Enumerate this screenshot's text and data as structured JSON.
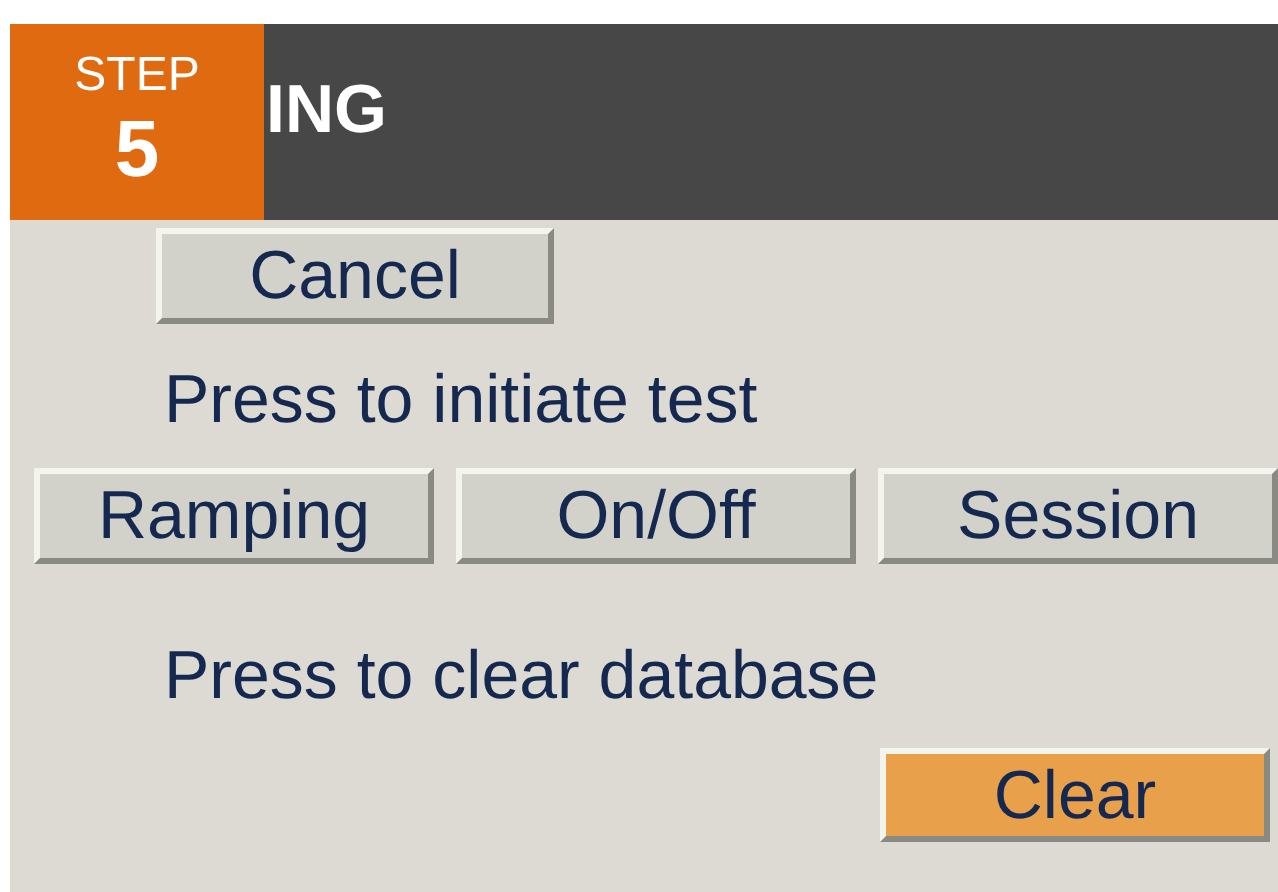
{
  "step_badge": {
    "label": "STEP",
    "number": "5"
  },
  "window": {
    "title": "ING"
  },
  "cancel_button": "Cancel",
  "test_prompt": "Press to initiate test",
  "test_buttons": [
    {
      "label": "Ramping"
    },
    {
      "label": "On/Off"
    },
    {
      "label": "Session"
    }
  ],
  "clear_prompt": "Press to clear database",
  "clear_button": {
    "label": "Clear",
    "highlighted": true
  }
}
